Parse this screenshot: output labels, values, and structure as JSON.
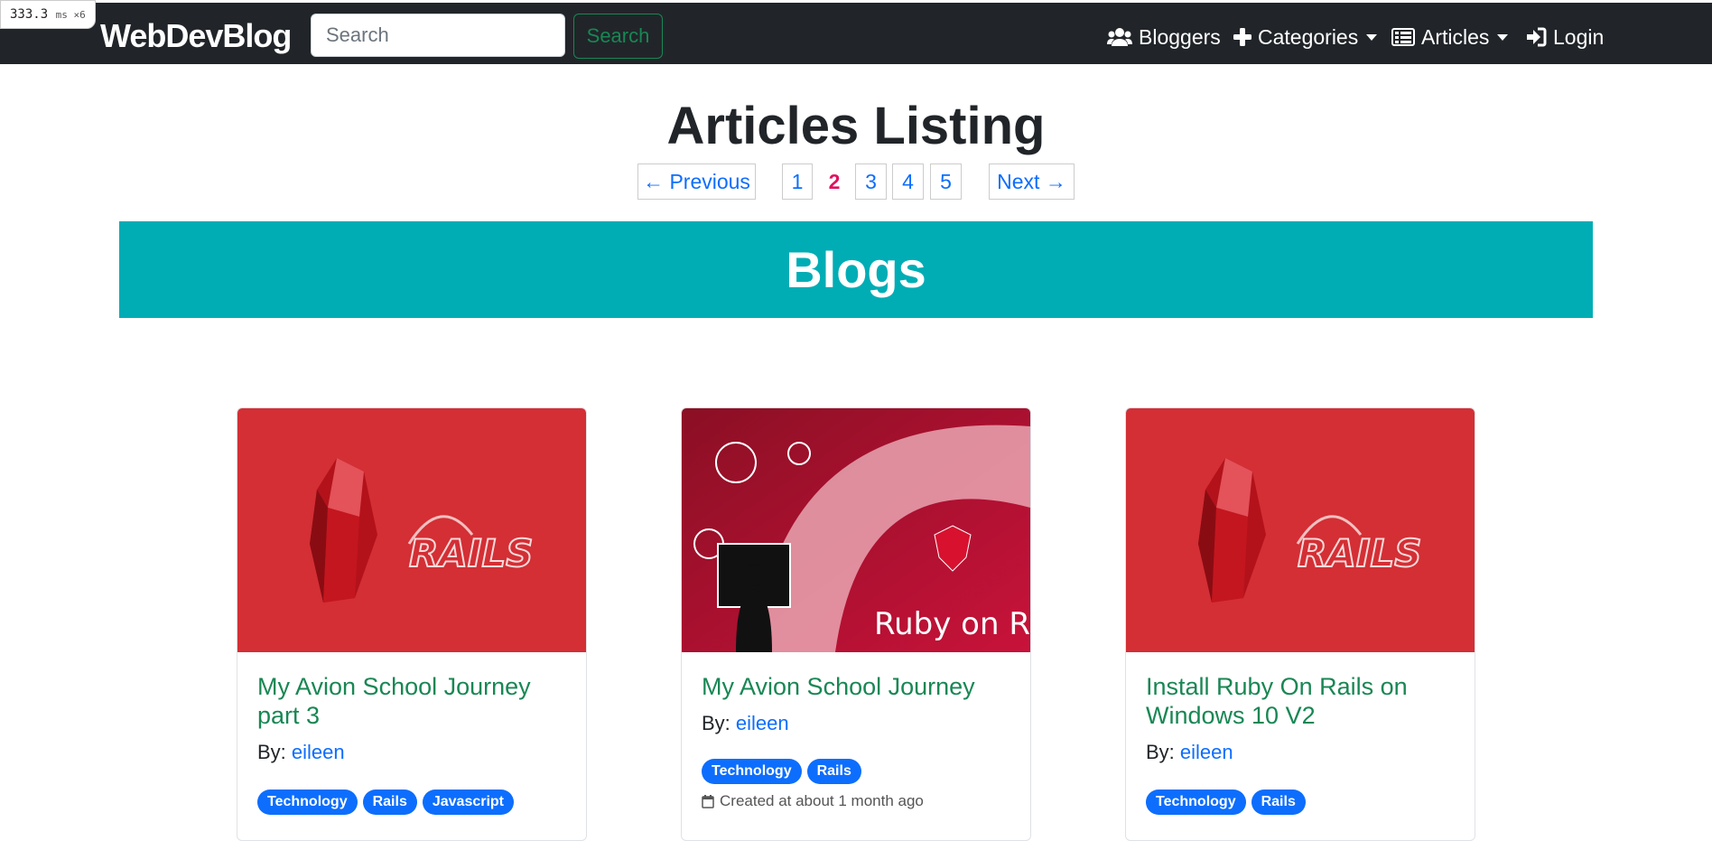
{
  "perf": {
    "value": "333.3",
    "unit": "ms ×6"
  },
  "navbar": {
    "brand": "WebDevBlog",
    "search_placeholder": "Search",
    "search_button": "Search",
    "items": [
      {
        "label": "Bloggers",
        "icon": "users-icon"
      },
      {
        "label": "Categories",
        "icon": "plus-icon",
        "dropdown": true
      },
      {
        "label": "Articles",
        "icon": "list-icon",
        "dropdown": true
      },
      {
        "label": "Login",
        "icon": "sign-in-icon"
      }
    ]
  },
  "page": {
    "title": "Articles Listing"
  },
  "pagination": {
    "previous": "← Previous",
    "next": "Next →",
    "pages": [
      "1",
      "2",
      "3",
      "4",
      "5"
    ],
    "current": "2"
  },
  "banner": {
    "title": "Blogs"
  },
  "cards": [
    {
      "title": "My Avion School Journey part 3",
      "by_label": "By:",
      "author": "eileen",
      "tags": [
        "Technology",
        "Rails",
        "Javascript"
      ],
      "image": "rails-logo-image"
    },
    {
      "title": "My Avion School Journey",
      "by_label": "By:",
      "author": "eileen",
      "tags": [
        "Technology",
        "Rails"
      ],
      "created": "Created at about 1 month ago",
      "image": "ruby-on-rails-image",
      "image_text": "Ruby on Rails"
    },
    {
      "title": "Install Ruby On Rails on Windows 10 V2",
      "by_label": "By:",
      "author": "eileen",
      "tags": [
        "Technology",
        "Rails"
      ],
      "image": "rails-logo-image"
    }
  ],
  "colors": {
    "navbar": "#212529",
    "banner": "#00adb5",
    "title_green": "#198754",
    "link_blue": "#0d6efd",
    "current_page": "#e0115f",
    "card_image_red": "#d32f35"
  }
}
